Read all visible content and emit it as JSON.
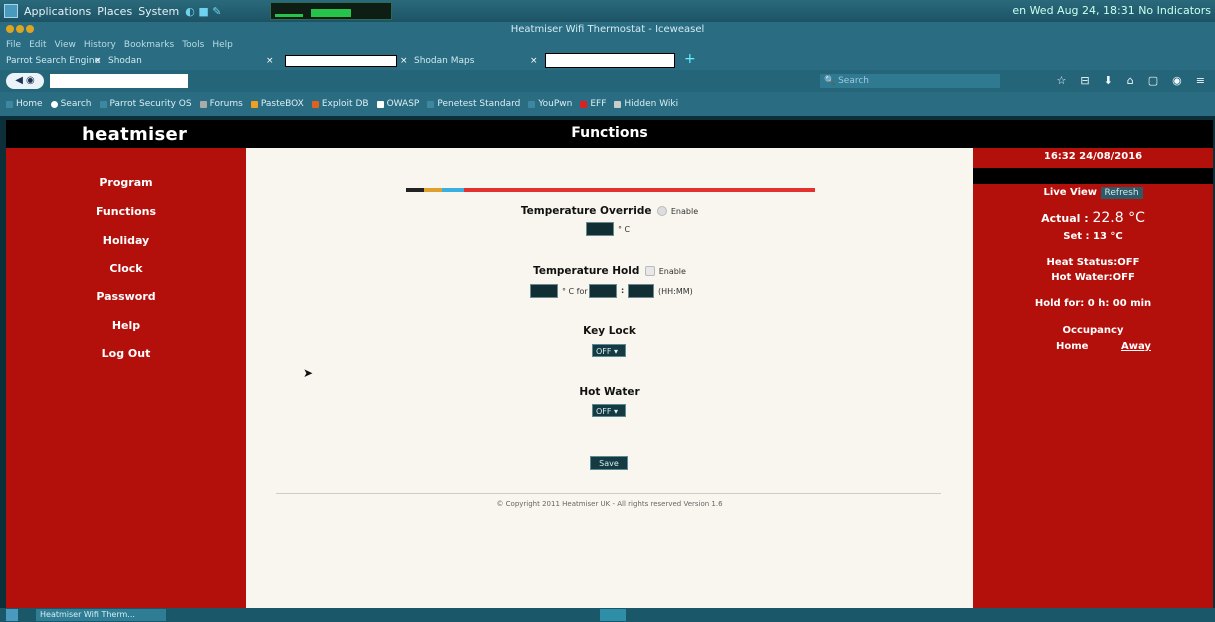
{
  "system_panel": {
    "menu": [
      "Applications",
      "Places",
      "System"
    ],
    "clock": "en  Wed Aug 24, 18:31 No Indicators"
  },
  "window": {
    "title": "Heatmiser Wifi Thermostat - Iceweasel"
  },
  "menu_bar": [
    "File",
    "Edit",
    "View",
    "History",
    "Bookmarks",
    "Tools",
    "Help"
  ],
  "tabs": [
    {
      "label": "Parrot Search Engine"
    },
    {
      "label": "Shodan"
    },
    {
      "label": "Shodan Maps"
    }
  ],
  "nav": {
    "search_placeholder": "Search"
  },
  "bookmarks": [
    "Home",
    "Search",
    "Parrot Security OS",
    "Forums",
    "PasteBOX",
    "Exploit DB",
    "OWASP",
    "Penetest Standard",
    "YouPwn",
    "EFF",
    "Hidden Wiki"
  ],
  "site": {
    "brand": "heatmiser",
    "page_title": "Functions"
  },
  "sidebar": {
    "items": [
      "Program",
      "Functions",
      "Holiday",
      "Clock",
      "Password",
      "Help",
      "Log Out"
    ]
  },
  "main": {
    "temp_override": {
      "label": "Temperature Override",
      "enable": "Enable",
      "unit": "° C"
    },
    "temp_hold": {
      "label": "Temperature Hold",
      "enable": "Enable",
      "unit_for": "° C for",
      "colon": ":",
      "format": "(HH:MM)"
    },
    "key_lock": {
      "label": "Key Lock",
      "value": "OFF"
    },
    "hot_water": {
      "label": "Hot Water",
      "value": "OFF"
    },
    "save_label": "Save",
    "copyright": "© Copyright 2011 Heatmiser UK - All rights reserved Version 1.6"
  },
  "right_panel": {
    "datetime": "16:32  24/08/2016",
    "live_view": "Live View",
    "refresh": "Refresh",
    "actual_label": "Actual :",
    "actual_value": "22.8 °C",
    "set": "Set : 13 °C",
    "heat_status": "Heat Status:OFF",
    "hot_water": "Hot Water:OFF",
    "hold_for": "Hold for: 0 h: 00 min",
    "occupancy": "Occupancy",
    "home": "Home",
    "away": "Away"
  },
  "taskbar": {
    "item": "Heatmiser Wifi Therm..."
  },
  "colors": {
    "sidebar_red": "#b30f0b",
    "header_black": "#000000",
    "main_bg": "#f8f6ee"
  }
}
